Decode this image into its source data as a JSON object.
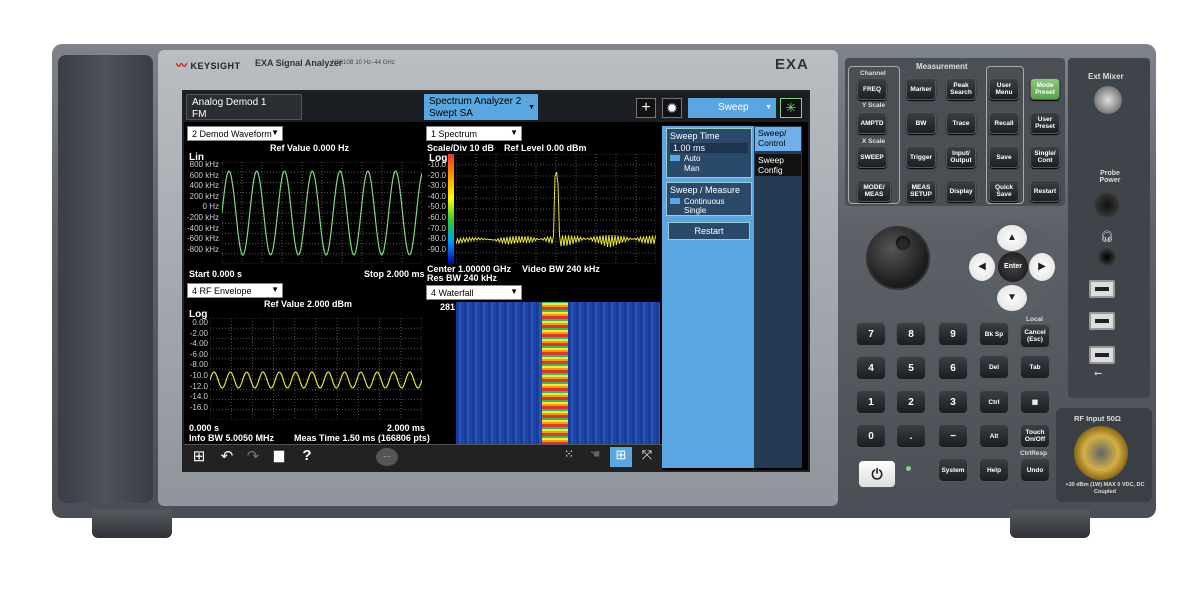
{
  "brand": {
    "logo": "KEYSIGHT",
    "model": "EXA Signal Analyzer",
    "model_number": "N9010B 10 Hz–44 GHz",
    "badge": "EXA"
  },
  "screen": {
    "tabs": [
      {
        "title": "Analog Demod 1",
        "subtitle": "FM"
      },
      {
        "title": "Spectrum Analyzer 2",
        "subtitle": "Swept SA"
      }
    ],
    "sweep_menu": "Sweep",
    "window1": {
      "selector": "2 Demod Waveform",
      "ref": "Ref Value 0.000 Hz",
      "scale": "Lin",
      "yticks": [
        "800 kHz",
        "600 kHz",
        "400 kHz",
        "200 kHz",
        "0 Hz",
        "-200 kHz",
        "-400 kHz",
        "-600 kHz",
        "-800 kHz"
      ],
      "start": "Start 0.000 s",
      "stop": "Stop 2.000 ms"
    },
    "window2": {
      "selector": "1 Spectrum",
      "scale": "Scale/Div 10 dB",
      "ref": "Ref Level 0.00 dBm",
      "scale_type": "Log",
      "yticks": [
        "-10.0",
        "-20.0",
        "-30.0",
        "-40.0",
        "-50.0",
        "-60.0",
        "-70.0",
        "-80.0",
        "-90.0"
      ],
      "center": "Center 1.00000 GHz",
      "vbw": "Video BW 240 kHz",
      "rbw": "Res BW 240 kHz"
    },
    "window3": {
      "selector": "4 RF Envelope",
      "ref": "Ref Value 2.000 dBm",
      "scale_type": "Log",
      "yticks": [
        "0.00",
        "-2.00",
        "-4.00",
        "-6.00",
        "-8.00",
        "-10.0",
        "-12.0",
        "-14.0",
        "-16.0"
      ],
      "start": "0.000 s",
      "stop": "2.000 ms",
      "info": "Info BW 5.0050 MHz",
      "meas_time": "Meas Time 1.50 ms (166806 pts)"
    },
    "window4": {
      "selector": "4 Waterfall",
      "count": "281"
    },
    "panel": {
      "sweep_time_label": "Sweep Time",
      "sweep_time_value": "1.00 ms",
      "auto": "Auto",
      "man": "Man",
      "sweep_measure": "Sweep / Measure",
      "continuous": "Continuous",
      "single": "Single",
      "restart": "Restart",
      "tabs": [
        "Sweep/ Control",
        "Sweep Config"
      ]
    }
  },
  "front_panel": {
    "measurement_label": "Measurement",
    "channel_label": "Channel",
    "yscale_label": "Y Scale",
    "xscale_label": "X Scale",
    "buttons": {
      "freq": "FREQ",
      "marker": "Marker",
      "peak": "Peak Search",
      "user_menu": "User Menu",
      "mode_preset": "Mode Preset",
      "amptd": "AMPTD",
      "bw": "BW",
      "trace": "Trace",
      "recall": "Recall",
      "user_preset": "User Preset",
      "sweep": "SWEEP",
      "trigger": "Trigger",
      "input_output": "Input/ Output",
      "save": "Save",
      "single_cont": "Single/ Cont",
      "mode_meas": "MODE/ MEAS",
      "meas_setup": "MEAS SETUP",
      "display": "Display",
      "quick_save": "Quick Save",
      "restart": "Restart"
    },
    "enter": "Enter",
    "keypad": [
      "7",
      "8",
      "9",
      "4",
      "5",
      "6",
      "1",
      "2",
      "3",
      "0",
      ".",
      "−"
    ],
    "keys": {
      "bksp": "Bk Sp",
      "local": "Local",
      "cancel": "Cancel (Esc)",
      "del": "Del",
      "tab": "Tab",
      "ctrl": "Ctrl",
      "alt": "Alt",
      "touch": "Touch On/Off",
      "ctrlresp": "CtrlResp",
      "system": "System",
      "help": "Help",
      "undo": "Undo"
    },
    "ext_mixer": "Ext Mixer",
    "probe_power": "Probe Power",
    "rf_input": "RF Input 50Ω",
    "rf_warning": "+30 dBm (1W) MAX 0 VDC, DC Coupled"
  },
  "colors": {
    "trace_green": "#7fd87f",
    "trace_yellow": "#e6e23a",
    "menu_blue": "#5aa6e0",
    "tab_blue": "#6fb0e8"
  }
}
